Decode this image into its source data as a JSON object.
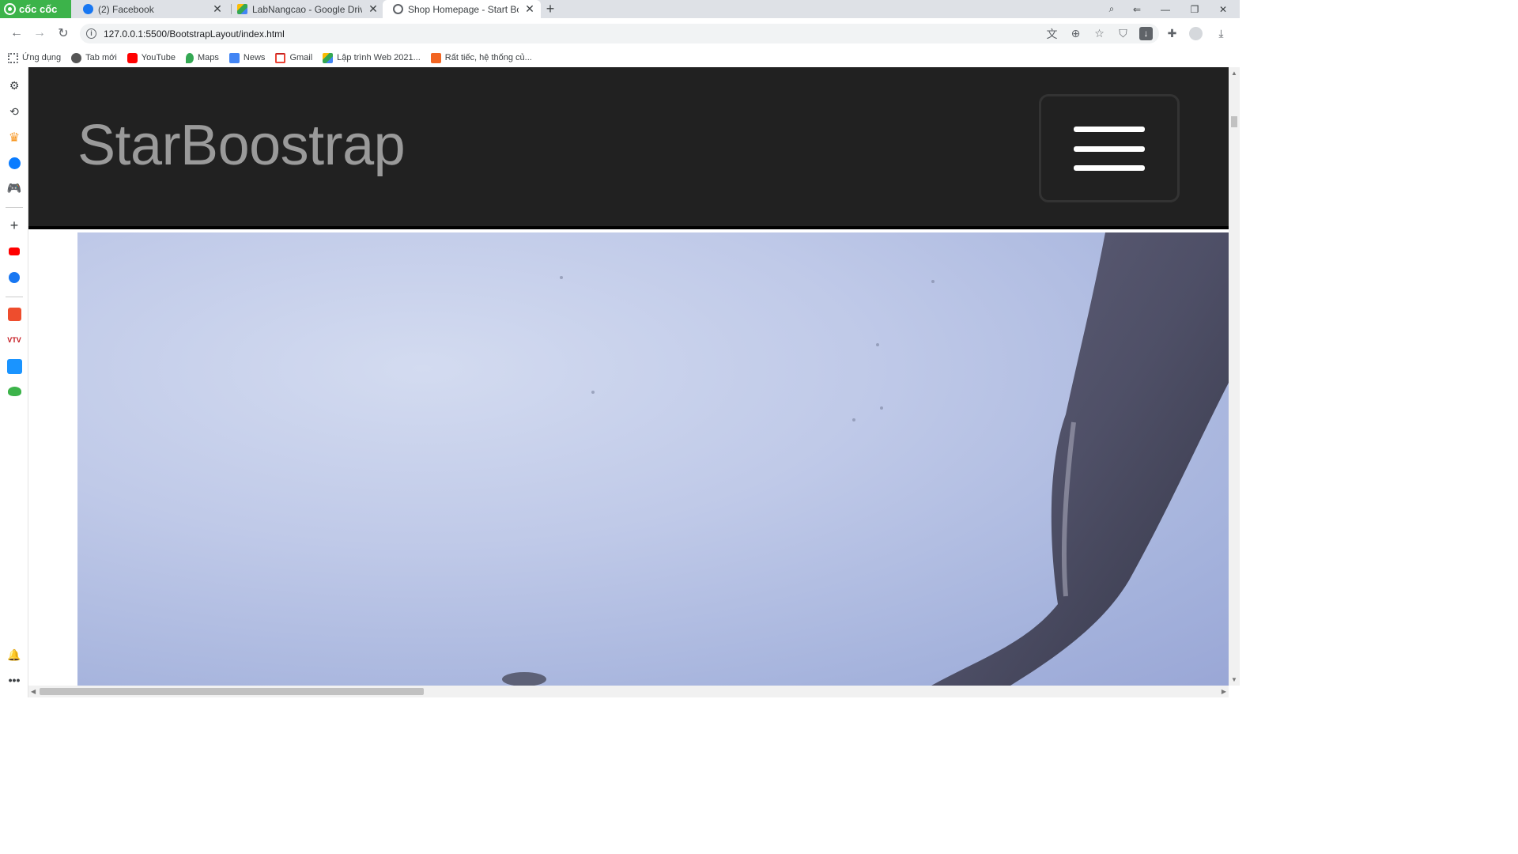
{
  "browser": {
    "brand": "cốc cốc",
    "tabs": [
      {
        "title": "(2) Facebook",
        "favicon": "facebook-icon",
        "color": "#1877f2"
      },
      {
        "title": "LabNangcao - Google Drive",
        "favicon": "google-drive-icon",
        "color": "#34a853"
      },
      {
        "title": "Shop Homepage - Start Boot",
        "favicon": "globe-icon",
        "color": "#5f6368",
        "active": true
      }
    ],
    "url": "127.0.0.1:5500/BootstrapLayout/index.html",
    "bookmarks": [
      {
        "label": "Ứng dụng",
        "icon": "apps-grid-icon",
        "color": "#5f6368"
      },
      {
        "label": "Tab mới",
        "icon": "coccoc-icon",
        "color": "#555555"
      },
      {
        "label": "YouTube",
        "icon": "youtube-icon",
        "color": "#ff0000"
      },
      {
        "label": "Maps",
        "icon": "maps-icon",
        "color": "#34a853"
      },
      {
        "label": "News",
        "icon": "google-news-icon",
        "color": "#4285f4"
      },
      {
        "label": "Gmail",
        "icon": "gmail-icon",
        "color": "#ea4335"
      },
      {
        "label": "Lập trình Web 2021...",
        "icon": "google-drive-icon",
        "color": "#fbbc04"
      },
      {
        "label": "Rất tiếc, hệ thống củ...",
        "icon": "error-page-icon",
        "color": "#f26522"
      }
    ]
  },
  "site": {
    "brand": "StarBoostrap",
    "navbar_bg": "#212121"
  }
}
